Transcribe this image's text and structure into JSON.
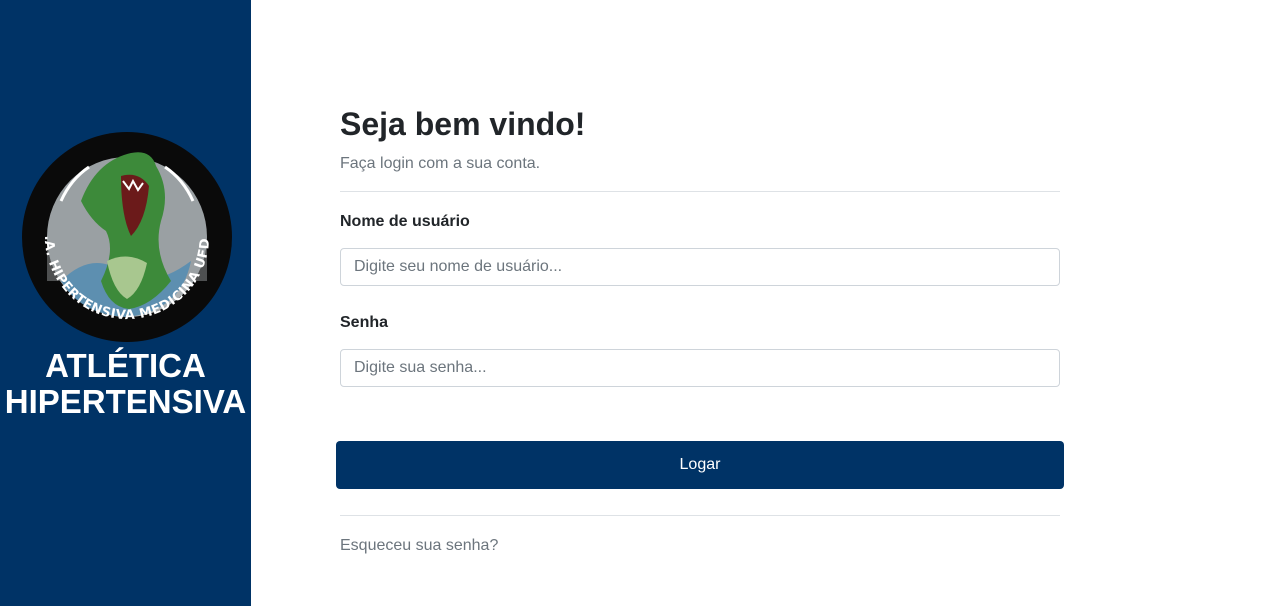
{
  "sidebar": {
    "logo_text": "A.A.A. HIPERTENSIVA MEDICINA UFDPAR",
    "brand_line1": "ATLÉTICA",
    "brand_line2": "HIPERTENSIVA"
  },
  "login": {
    "title": "Seja bem vindo!",
    "subtitle": "Faça login com a sua conta.",
    "username_label": "Nome de usuário",
    "username_placeholder": "Digite seu nome de usuário...",
    "password_label": "Senha",
    "password_placeholder": "Digite sua senha...",
    "submit_label": "Logar",
    "forgot_label": "Esqueceu sua senha?"
  },
  "colors": {
    "brand": "#003366",
    "text": "#212529",
    "muted": "#6c757d"
  }
}
